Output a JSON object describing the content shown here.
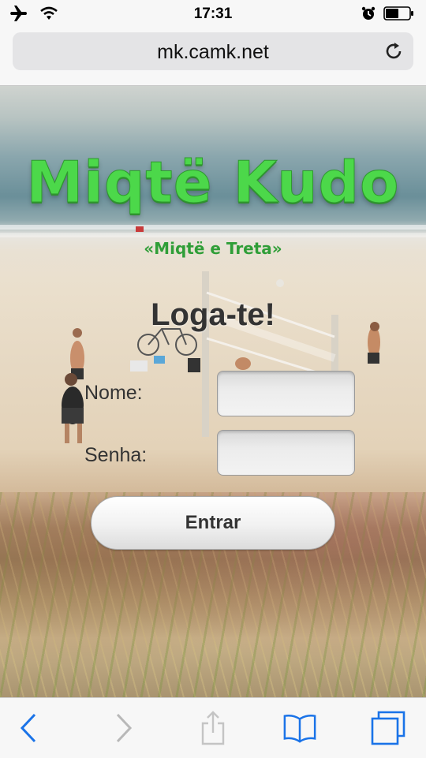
{
  "status_bar": {
    "time": "17:31",
    "icons": [
      "airplane-icon",
      "wifi-icon",
      "alarm-icon",
      "battery-icon"
    ]
  },
  "browser": {
    "url": "mk.camk.net",
    "toolbar_icons": [
      "back-icon",
      "forward-icon",
      "share-icon",
      "bookmarks-icon",
      "tabs-icon"
    ],
    "accent_color": "#1a73e8"
  },
  "page": {
    "logo_title": "Miqtë Kudo",
    "logo_subtitle": "«Miqtë e Treta»",
    "heading": "Loga-te!",
    "form": {
      "name_label": "Nome:",
      "name_value": "",
      "password_label": "Senha:",
      "password_value": "",
      "submit_label": "Entrar"
    },
    "logo_color": "#4cd84a"
  }
}
